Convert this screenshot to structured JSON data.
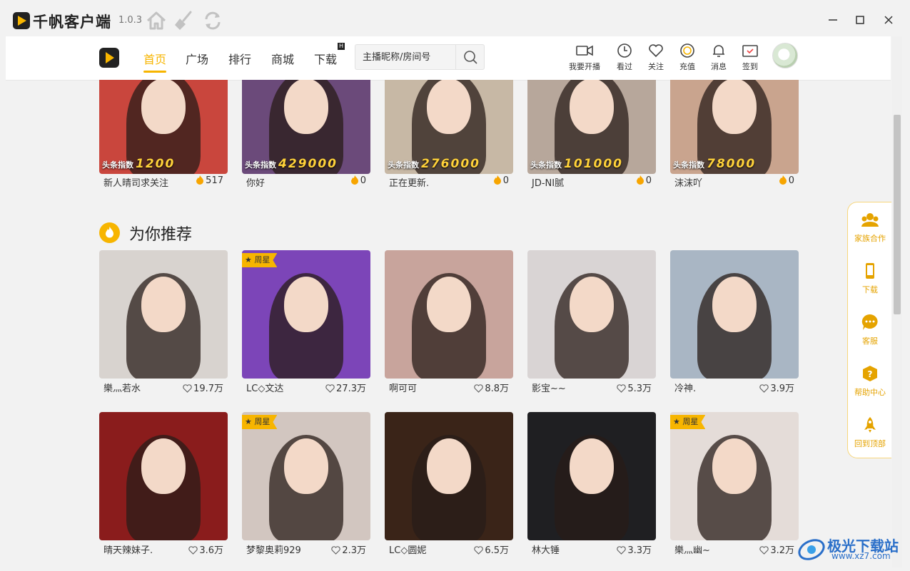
{
  "app": {
    "title": "千帆客户端",
    "version": "1.0.3"
  },
  "nav": {
    "tabs": [
      {
        "label": "首页",
        "active": true
      },
      {
        "label": "广场"
      },
      {
        "label": "排行"
      },
      {
        "label": "商城"
      },
      {
        "label": "下载",
        "badge": "H"
      }
    ],
    "search_placeholder": "主播昵称/房间号",
    "actions": [
      {
        "label": "我要开播",
        "icon": "camera-icon"
      },
      {
        "label": "看过",
        "icon": "clock-icon"
      },
      {
        "label": "关注",
        "icon": "heart-icon"
      },
      {
        "label": "充值",
        "icon": "coin-icon"
      },
      {
        "label": "消息",
        "icon": "bell-icon"
      },
      {
        "label": "签到",
        "icon": "calendar-icon"
      }
    ]
  },
  "headline_cards": [
    {
      "name": "新人晴司求关注",
      "count": "517",
      "hot_label": "头条指数",
      "hot_value": "1200",
      "bg": "#c9463d"
    },
    {
      "name": "你好",
      "count": "0",
      "hot_label": "头条指数",
      "hot_value": "429000",
      "bg": "#6b4a7a"
    },
    {
      "name": "正在更新.",
      "count": "0",
      "hot_label": "头条指数",
      "hot_value": "276000",
      "bg": "#c7b8a5"
    },
    {
      "name": "JD-NI腻",
      "count": "0",
      "hot_label": "头条指数",
      "hot_value": "101000",
      "bg": "#b7a79b"
    },
    {
      "name": "沫沫吖",
      "count": "0",
      "hot_label": "头条指数",
      "hot_value": "78000",
      "bg": "#c9a48e"
    }
  ],
  "section": {
    "title": "为你推荐"
  },
  "recommend_cards": [
    {
      "name": "樂灬若水",
      "count": "19.7万",
      "bg": "#d8d3cf",
      "tag": ""
    },
    {
      "name": "LC◇文达",
      "count": "27.3万",
      "bg": "#7c45b8",
      "tag": "周星"
    },
    {
      "name": "啊可可",
      "count": "8.8万",
      "bg": "#c8a49c",
      "tag": ""
    },
    {
      "name": "影宝~~",
      "count": "5.3万",
      "bg": "#d9d4d4",
      "tag": ""
    },
    {
      "name": "冷神.",
      "count": "3.9万",
      "bg": "#a9b6c4",
      "tag": ""
    },
    {
      "name": "晴天辣妹子.",
      "count": "3.6万",
      "bg": "#8a1c1c",
      "tag": ""
    },
    {
      "name": "梦黎奥莉929",
      "count": "2.3万",
      "bg": "#d2c6c0",
      "tag": "周星"
    },
    {
      "name": "LC◇圆妮",
      "count": "6.5万",
      "bg": "#3a2418",
      "tag": ""
    },
    {
      "name": "林大锤",
      "count": "3.3万",
      "bg": "#1f1f22",
      "tag": ""
    },
    {
      "name": "樂灬幽~",
      "count": "3.2万",
      "bg": "#e4dcd8",
      "tag": "周星"
    }
  ],
  "side_panel": [
    {
      "label": "家族合作",
      "icon": "family-icon"
    },
    {
      "label": "下载",
      "icon": "phone-icon"
    },
    {
      "label": "客服",
      "icon": "chat-icon"
    },
    {
      "label": "帮助中心",
      "icon": "help-icon"
    },
    {
      "label": "回到顶部",
      "icon": "rocket-icon"
    }
  ],
  "watermark": {
    "text": "极光下载站",
    "url": "www.xz7.com"
  },
  "colors": {
    "accent": "#f7b500",
    "side_text": "#e5a300"
  }
}
